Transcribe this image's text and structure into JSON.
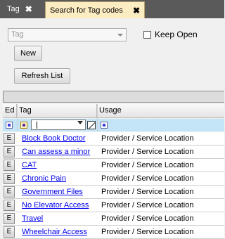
{
  "tabs": [
    {
      "label": "Tag",
      "active": false
    },
    {
      "label": "Search for Tag codes",
      "active": true
    }
  ],
  "tab_close_glyph": "✖",
  "form": {
    "tag_combo_placeholder": "Tag",
    "keep_open_label": "Keep Open",
    "keep_open_checked": false,
    "new_button": "New",
    "refresh_button": "Refresh List"
  },
  "grid": {
    "columns": [
      "Ed",
      "Tag",
      "Usage"
    ],
    "filter_value": "",
    "edit_glyph": "E",
    "rows": [
      {
        "tag": "Block Book Doctor",
        "usage": "Provider / Service Location"
      },
      {
        "tag": "Can assess a minor",
        "usage": "Provider / Service Location"
      },
      {
        "tag": "CAT",
        "usage": "Provider / Service Location"
      },
      {
        "tag": "Chronic Pain",
        "usage": "Provider / Service Location"
      },
      {
        "tag": "Government Files",
        "usage": "Provider / Service Location"
      },
      {
        "tag": "No Elevator Access",
        "usage": "Provider / Service Location"
      },
      {
        "tag": "Travel",
        "usage": "Provider / Service Location"
      },
      {
        "tag": "Wheelchair Access",
        "usage": "Provider / Service Location"
      }
    ]
  },
  "colors": {
    "active_tab": "#fcecc2",
    "tab_bar": "#5a5a5a",
    "filter_row": "#c4e4f7",
    "link": "#0000ee"
  }
}
